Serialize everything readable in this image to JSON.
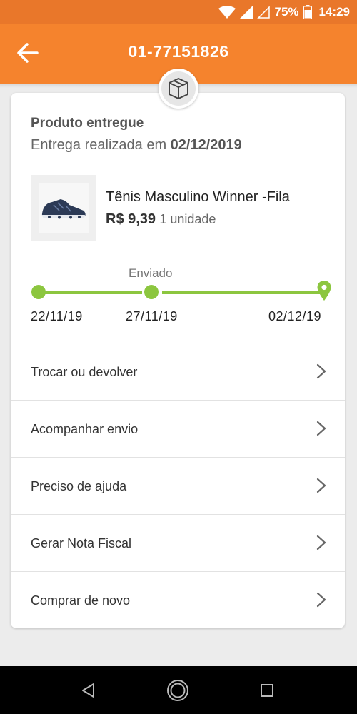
{
  "status_bar": {
    "battery": "75%",
    "time": "14:29"
  },
  "header": {
    "order_number": "01-77151826"
  },
  "delivery": {
    "title": "Produto entregue",
    "date_prefix": "Entrega realizada em",
    "date": "02/12/2019"
  },
  "product": {
    "name": "Tênis Masculino Winner -Fila",
    "price": "R$ 9,39",
    "quantity": "1 unidade"
  },
  "tracking": {
    "status_label": "Enviado",
    "dates": [
      "22/11/19",
      "27/11/19",
      "02/12/19"
    ]
  },
  "menu": [
    {
      "label": "Trocar ou devolver"
    },
    {
      "label": "Acompanhar envio"
    },
    {
      "label": "Preciso de ajuda"
    },
    {
      "label": "Gerar Nota Fiscal"
    },
    {
      "label": "Comprar de novo"
    }
  ],
  "colors": {
    "header_orange": "#f5832d",
    "status_bar_orange": "#e9772a",
    "track_green": "#8cc63f",
    "nav_black": "#000000"
  },
  "icons": {
    "back": "arrow-left-icon",
    "package": "package-box-icon",
    "chevron": "chevron-right-icon",
    "nav_back": "triangle-back-icon",
    "nav_home": "circle-home-icon",
    "nav_recents": "square-recents-icon"
  }
}
